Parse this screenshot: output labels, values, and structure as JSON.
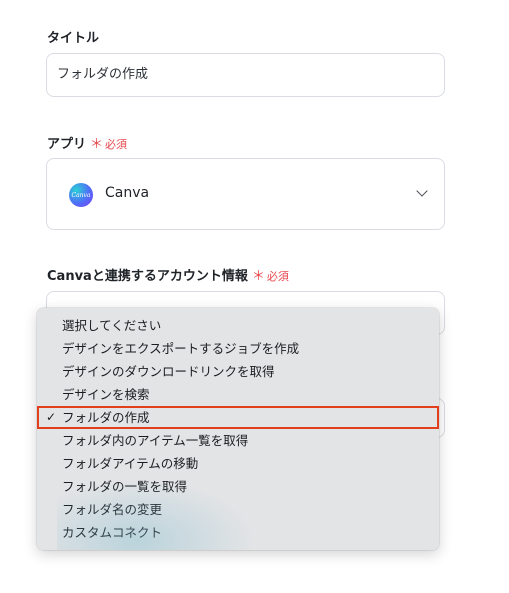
{
  "title_field": {
    "label": "タイトル",
    "value": "フォルダの作成"
  },
  "app_field": {
    "label": "アプリ",
    "required_mark": "＊",
    "required_text": "必須",
    "app_name": "Canva",
    "logo_text": "Canva"
  },
  "account_field": {
    "label": "Canvaと連携するアカウント情報",
    "required_mark": "＊",
    "required_text": "必須"
  },
  "action_dropdown": {
    "options": [
      "選択してください",
      "デザインをエクスポートするジョブを作成",
      "デザインのダウンロードリンクを取得",
      "デザインを検索",
      "フォルダの作成",
      "フォルダ内のアイテム一覧を取得",
      "フォルダアイテムの移動",
      "フォルダの一覧を取得",
      "フォルダ名の変更",
      "カスタムコネクト"
    ],
    "selected": "フォルダの作成",
    "check_glyph": "✓"
  },
  "colors": {
    "required": "#e5484d",
    "highlight": "#e2401c",
    "border": "#d9dde3"
  }
}
